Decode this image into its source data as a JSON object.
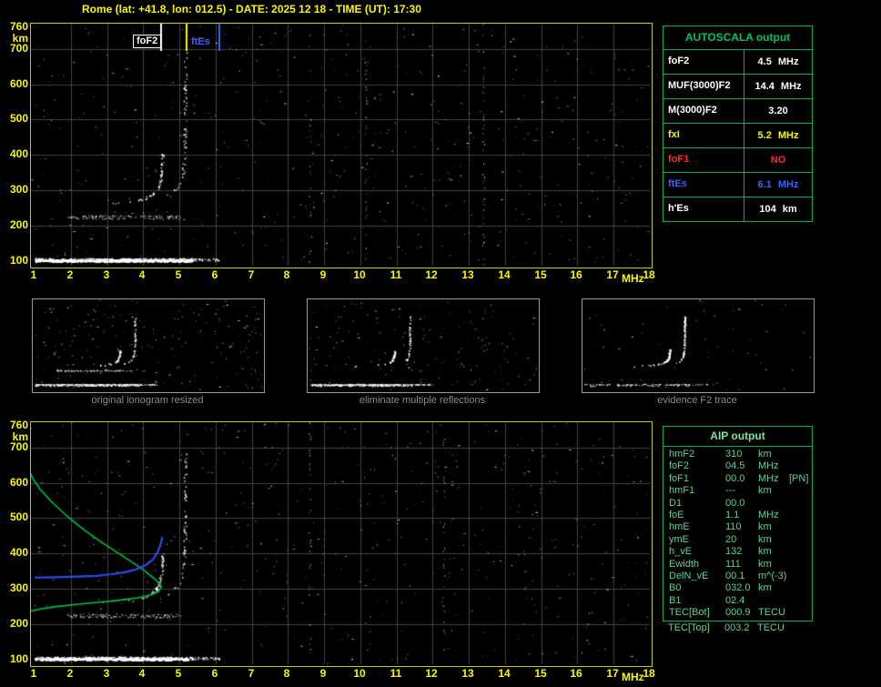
{
  "header": {
    "title": "Rome (lat: +41.8, lon: 012.5) - DATE: 2025 12 18 - TIME (UT): 17:30"
  },
  "colors": {
    "yellow": "#f8f800",
    "plot_border": "#c8c800",
    "grid": "#424242",
    "table_green": "#00b050",
    "aip_text": "#5bd48b",
    "red": "#ff2a2a",
    "blue": "#3a62ff",
    "white": "#ffffff",
    "caption_gray": "#8c8c8c",
    "profile_green": "#00c040",
    "trace_blue": "#2b4bf0"
  },
  "main_plot": {
    "y_unit": "km",
    "x_unit": "MHz",
    "y_ticks": [
      760,
      700,
      600,
      500,
      400,
      300,
      200,
      100
    ],
    "x_ticks": [
      1,
      2,
      3,
      4,
      5,
      6,
      7,
      8,
      9,
      10,
      11,
      12,
      13,
      14,
      15,
      16,
      17,
      18
    ],
    "markers": [
      {
        "label": "foF2",
        "freq": 4.5,
        "color": "#ffffff"
      },
      {
        "label": "",
        "freq": 5.2,
        "color": "#f8f800"
      },
      {
        "label": "ftEs",
        "freq": 6.1,
        "color": "#3a62ff"
      }
    ],
    "traces": {
      "es_layer_km": 104,
      "es_second_hop_km": 225,
      "f2_o_cusp_mhz": 4.5,
      "f2_x_cusp_mhz": 5.2
    }
  },
  "bottom_plot": {
    "y_unit": "km",
    "x_unit": "MHz",
    "y_ticks": [
      760,
      700,
      600,
      500,
      400,
      300,
      200,
      100
    ],
    "x_ticks": [
      1,
      2,
      3,
      4,
      5,
      6,
      7,
      8,
      9,
      10,
      11,
      12,
      13,
      14,
      15,
      16,
      17,
      18
    ],
    "profile": [
      [
        0.72,
        668
      ],
      [
        0.82,
        641
      ],
      [
        0.95,
        612
      ],
      [
        1.15,
        582
      ],
      [
        1.45,
        548
      ],
      [
        1.85,
        510
      ],
      [
        2.35,
        468
      ],
      [
        2.9,
        428
      ],
      [
        3.45,
        392
      ],
      [
        3.95,
        358
      ],
      [
        4.3,
        330
      ],
      [
        4.47,
        314
      ],
      [
        4.5,
        306
      ],
      [
        4.43,
        293
      ],
      [
        4.22,
        283
      ],
      [
        3.85,
        275
      ],
      [
        3.35,
        268
      ],
      [
        2.75,
        262
      ],
      [
        2.15,
        256
      ],
      [
        1.6,
        250
      ],
      [
        1.2,
        244
      ],
      [
        0.92,
        238
      ],
      [
        0.74,
        232
      ]
    ],
    "restored_trace": [
      [
        1.0,
        332
      ],
      [
        1.6,
        333
      ],
      [
        2.2,
        335
      ],
      [
        2.7,
        337
      ],
      [
        3.1,
        341
      ],
      [
        3.5,
        347
      ],
      [
        3.8,
        355
      ],
      [
        4.05,
        366
      ],
      [
        4.25,
        381
      ],
      [
        4.38,
        399
      ],
      [
        4.47,
        421
      ],
      [
        4.53,
        447
      ]
    ]
  },
  "thumbnails": [
    {
      "caption": "original ionogram resized"
    },
    {
      "caption": "eliminate multiple reflections"
    },
    {
      "caption": "evidence F2 trace"
    }
  ],
  "autoscala_table": {
    "title": "AUTOSCALA output",
    "rows": [
      {
        "label": "foF2",
        "value": "4.5",
        "unit": "MHz",
        "color": "#ffffff"
      },
      {
        "label": "MUF(3000)F2",
        "value": "14.4",
        "unit": "MHz",
        "color": "#ffffff"
      },
      {
        "label": "M(3000)F2",
        "value": "3.20",
        "unit": "",
        "color": "#ffffff"
      },
      {
        "label": "fxI",
        "value": "5.2",
        "unit": "MHz",
        "color": "#f8f800"
      },
      {
        "label": "foF1",
        "value": "NO",
        "unit": "",
        "color": "#ff2a2a"
      },
      {
        "label": "ftEs",
        "value": "6.1",
        "unit": "MHz",
        "color": "#3a62ff"
      },
      {
        "label": "h'Es",
        "value": "104",
        "unit": "km",
        "color": "#ffffff"
      }
    ]
  },
  "aip_table": {
    "title": "AIP output",
    "rows": [
      {
        "label": "hmF2",
        "value": "310",
        "unit": "km",
        "note": ""
      },
      {
        "label": "foF2",
        "value": "04.5",
        "unit": "MHz",
        "note": ""
      },
      {
        "label": "foF1",
        "value": "00.0",
        "unit": "MHz",
        "note": "[PN]"
      },
      {
        "label": "hmF1",
        "value": "---",
        "unit": "km",
        "note": ""
      },
      {
        "label": "D1",
        "value": "00.0",
        "unit": "",
        "note": ""
      },
      {
        "label": "foE",
        "value": "1.1",
        "unit": "MHz",
        "note": ""
      },
      {
        "label": "hmE",
        "value": "110",
        "unit": "km",
        "note": ""
      },
      {
        "label": "ymE",
        "value": "20",
        "unit": "km",
        "note": ""
      },
      {
        "label": "h_vE",
        "value": "132",
        "unit": "km",
        "note": ""
      },
      {
        "label": "Ewidth",
        "value": "111",
        "unit": "km",
        "note": ""
      },
      {
        "label": "DelN_vE",
        "value": "00.1",
        "unit": "m^(-3)",
        "note": ""
      },
      {
        "label": "B0",
        "value": "032.0",
        "unit": "km",
        "note": ""
      },
      {
        "label": "B1",
        "value": "02.4",
        "unit": "",
        "note": ""
      },
      {
        "label": "TEC[Bot]",
        "value": "000.9",
        "unit": "TECU",
        "note": ""
      },
      {
        "label": "TEC[Top]",
        "value": "003.2",
        "unit": "TECU",
        "note": ""
      }
    ]
  }
}
